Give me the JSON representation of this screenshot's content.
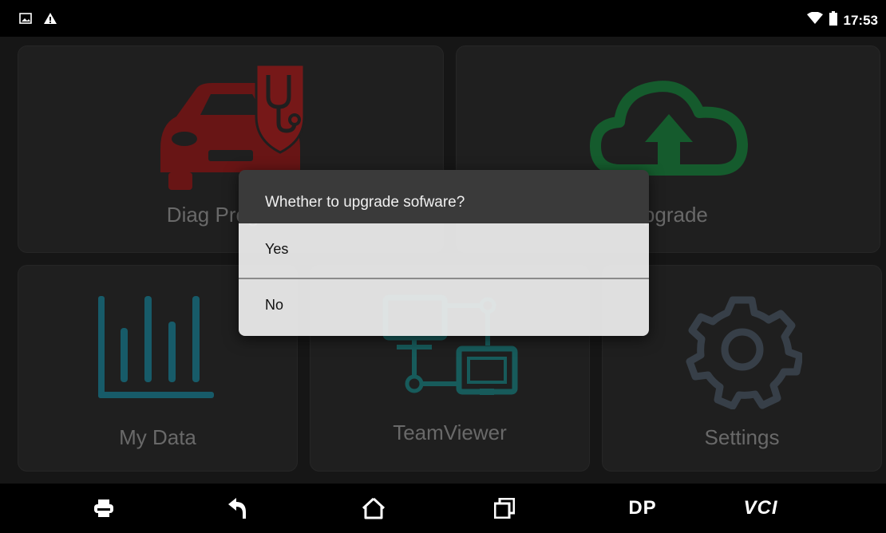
{
  "status_bar": {
    "time": "17:53",
    "left_icons": [
      "image-icon",
      "warning-icon"
    ],
    "right_icons": [
      "wifi-icon",
      "battery-icon"
    ]
  },
  "tiles": {
    "diag": {
      "label": "Diag Program",
      "icon": "car-diagnostic-icon",
      "color": "#8b1c1c"
    },
    "upgrade": {
      "label": "Upgrade",
      "icon": "cloud-upload-icon",
      "color": "#1c7a3c"
    },
    "my_data": {
      "label": "My Data",
      "icon": "bar-chart-icon",
      "color": "#1f7a8c"
    },
    "teamviewer": {
      "label": "TeamViewer",
      "icon": "network-icon",
      "color": "#1f7a7a"
    },
    "settings": {
      "label": "Settings",
      "icon": "gear-icon",
      "color": "#4a5560"
    }
  },
  "dialog": {
    "title": "Whether to upgrade sofware?",
    "options": [
      "Yes",
      "No"
    ]
  },
  "nav_bar": {
    "dp_label": "DP",
    "vci_label": "VCI",
    "icons": [
      "print-icon",
      "back-icon",
      "home-icon",
      "recent-apps-icon"
    ]
  }
}
